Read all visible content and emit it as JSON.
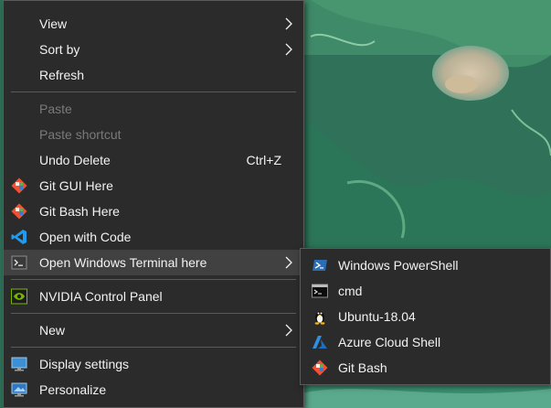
{
  "context_menu": {
    "items": [
      {
        "label": "View"
      },
      {
        "label": "Sort by"
      },
      {
        "label": "Refresh"
      },
      {
        "label": "Paste"
      },
      {
        "label": "Paste shortcut"
      },
      {
        "label": "Undo Delete",
        "shortcut": "Ctrl+Z"
      },
      {
        "label": "Git GUI Here",
        "icon": "git-gui-icon"
      },
      {
        "label": "Git Bash Here",
        "icon": "git-bash-icon"
      },
      {
        "label": "Open with Code",
        "icon": "vscode-icon"
      },
      {
        "label": "Open Windows Terminal here",
        "icon": "terminal-icon"
      },
      {
        "label": "NVIDIA Control Panel",
        "icon": "nvidia-icon"
      },
      {
        "label": "New"
      },
      {
        "label": "Display settings",
        "icon": "display-icon"
      },
      {
        "label": "Personalize",
        "icon": "personalize-icon"
      }
    ]
  },
  "terminal_submenu": {
    "items": [
      {
        "label": "Windows PowerShell",
        "icon": "powershell-icon"
      },
      {
        "label": "cmd",
        "icon": "cmd-icon"
      },
      {
        "label": "Ubuntu-18.04",
        "icon": "tux-icon"
      },
      {
        "label": "Azure Cloud Shell",
        "icon": "azure-icon"
      },
      {
        "label": "Git Bash",
        "icon": "git-icon"
      }
    ]
  },
  "colors": {
    "menu_bg": "#2b2b2b",
    "highlight": "#414141",
    "disabled_text": "#7a7a7a",
    "text": "#f2f2f2"
  }
}
